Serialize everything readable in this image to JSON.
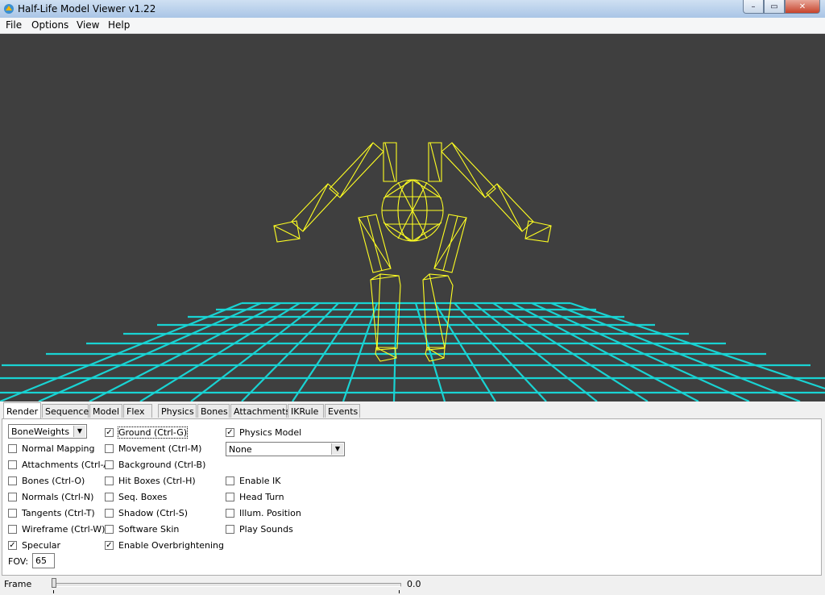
{
  "window": {
    "title": "Half-Life Model Viewer v1.22",
    "buttons": {
      "minimize": "–",
      "maximize": "▭",
      "close": "✕"
    }
  },
  "menu": {
    "items": [
      "File",
      "Options",
      "View",
      "Help"
    ]
  },
  "colors": {
    "viewport_bg": "#3f3f3f",
    "ground_grid": "#19d3d3",
    "model_wireframe": "#ffff22"
  },
  "tabs": [
    "Render",
    "Sequence",
    "Model",
    "Flex",
    "Physics",
    "Bones",
    "Attachments",
    "IKRule",
    "Events"
  ],
  "active_tab": "Render",
  "render": {
    "render_mode": {
      "value": "BoneWeights"
    },
    "column1": [
      {
        "label": "Normal Mapping",
        "checked": false
      },
      {
        "label": "Attachments (Ctrl-A)",
        "checked": false
      },
      {
        "label": "Bones (Ctrl-O)",
        "checked": false
      },
      {
        "label": "Normals (Ctrl-N)",
        "checked": false
      },
      {
        "label": "Tangents (Ctrl-T)",
        "checked": false
      },
      {
        "label": "Wireframe (Ctrl-W)",
        "checked": false
      },
      {
        "label": "Specular",
        "checked": true
      }
    ],
    "column2": [
      {
        "label": "Ground (Ctrl-G)",
        "checked": true
      },
      {
        "label": "Movement (Ctrl-M)",
        "checked": false
      },
      {
        "label": "Background (Ctrl-B)",
        "checked": false
      },
      {
        "label": "Hit Boxes (Ctrl-H)",
        "checked": false
      },
      {
        "label": "Seq. Boxes",
        "checked": false
      },
      {
        "label": "Shadow (Ctrl-S)",
        "checked": false
      },
      {
        "label": "Software Skin",
        "checked": false
      },
      {
        "label": "Enable Overbrightening",
        "checked": true
      }
    ],
    "physics_model": {
      "label": "Physics Model",
      "checked": true
    },
    "physics_select": {
      "value": "None"
    },
    "column3": [
      {
        "label": "Enable IK",
        "checked": false
      },
      {
        "label": "Head Turn",
        "checked": false
      },
      {
        "label": "Illum. Position",
        "checked": false
      },
      {
        "label": "Play Sounds",
        "checked": false
      }
    ],
    "fov": {
      "label": "FOV:",
      "value": "65"
    }
  },
  "frame": {
    "label": "Frame",
    "value": "0.0",
    "position": 0.0
  }
}
